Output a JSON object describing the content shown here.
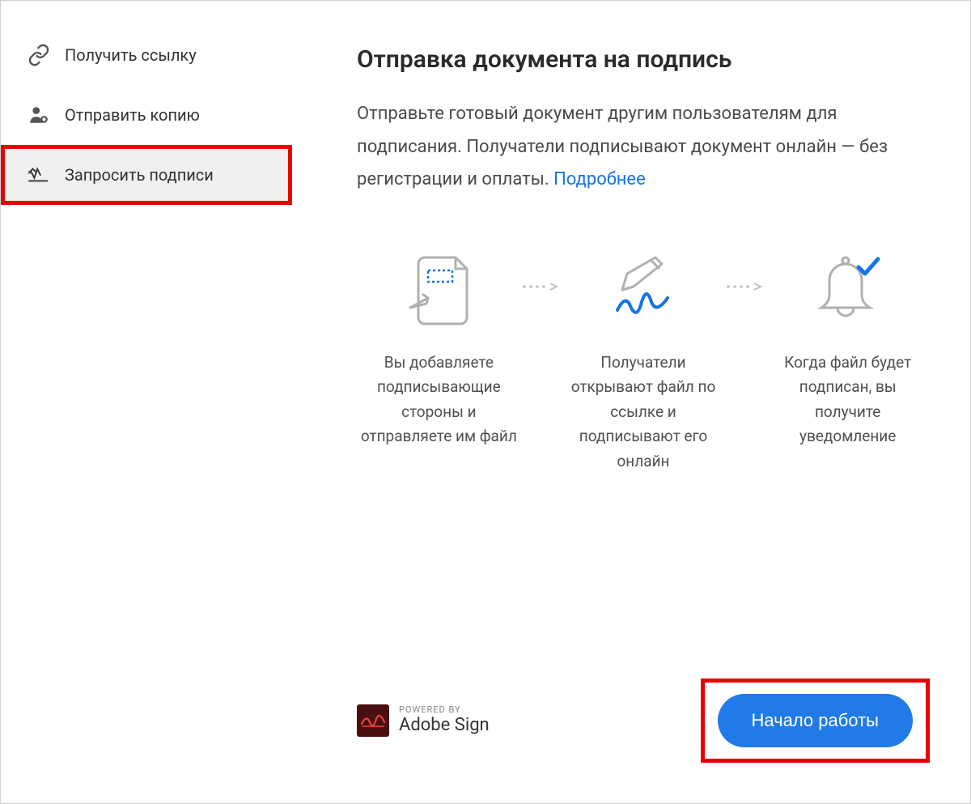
{
  "sidebar": {
    "items": [
      {
        "label": "Получить ссылку",
        "icon": "link-icon"
      },
      {
        "label": "Отправить копию",
        "icon": "user-copy-icon"
      },
      {
        "label": "Запросить подписи",
        "icon": "signature-icon"
      }
    ]
  },
  "main": {
    "heading": "Отправка документа на подпись",
    "description_part1": "Отправьте готовый документ другим пользователям для подписания. Получатели подписывают документ онлайн — без регистрации и оплаты. ",
    "link_label": "Подробнее"
  },
  "steps": [
    {
      "text": "Вы добавляете подписывающие стороны и отправляете им файл"
    },
    {
      "text": "Получатели открывают файл по ссылке и подписывают его онлайн"
    },
    {
      "text": "Когда файл будет подписан, вы получите уведомление"
    }
  ],
  "footer": {
    "powered_small": "POWERED BY",
    "powered_brand": "Adobe Sign",
    "cta_label": "Начало работы"
  }
}
